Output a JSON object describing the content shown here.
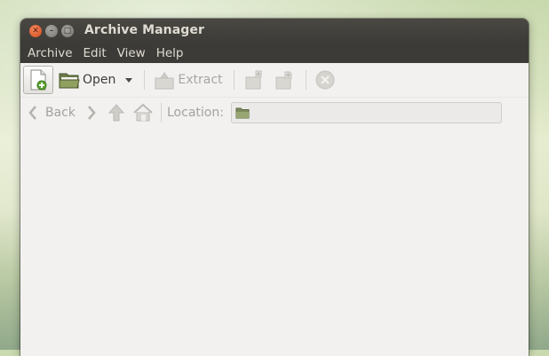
{
  "window": {
    "title": "Archive Manager"
  },
  "menubar": {
    "items": [
      "Archive",
      "Edit",
      "View",
      "Help"
    ]
  },
  "toolbar": {
    "new_icon": "new-archive-icon",
    "open_label": "Open",
    "extract_label": "Extract",
    "add_files_icon": "add-files-icon",
    "add_folder_icon": "add-folder-icon",
    "stop_icon": "stop-icon"
  },
  "location_bar": {
    "back_label": "Back",
    "location_label": "Location:",
    "location_value": ""
  },
  "colors": {
    "titlebar": "#3c3b37",
    "window_bg": "#f2f1f0",
    "close_button": "#df4b16",
    "disabled_text": "#a4a29d"
  }
}
